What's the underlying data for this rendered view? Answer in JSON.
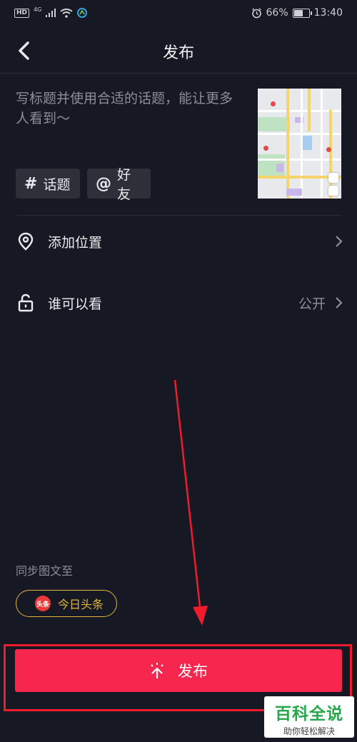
{
  "status_bar": {
    "hd": "HD",
    "network": "4G",
    "battery": "66%",
    "battery_level": 0.66,
    "time": "13:40"
  },
  "header": {
    "title": "发布"
  },
  "caption": {
    "placeholder": "写标题并使用合适的话题，能让更多人看到～"
  },
  "chips": [
    {
      "symbol": "#",
      "label": "话题"
    },
    {
      "symbol": "@",
      "label": "好友"
    }
  ],
  "rows": {
    "location": {
      "label": "添加位置"
    },
    "visibility": {
      "label": "谁可以看",
      "value": "公开"
    }
  },
  "sync": {
    "label": "同步图文至",
    "toutiao_logo": "头条",
    "toutiao_label": "今日头条"
  },
  "publish": {
    "label": "发布"
  },
  "watermark": {
    "title": "百科全说",
    "subtitle": "助你轻松解决"
  },
  "colors": {
    "background": "#161823",
    "accent": "#f6264f",
    "gold": "#e0b73c",
    "annotation_red": "#f01c2c"
  }
}
